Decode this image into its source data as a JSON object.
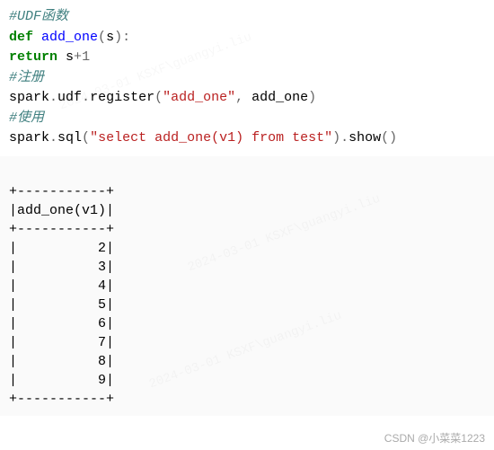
{
  "code": {
    "comment1": "#UDF函数",
    "kw_def": "def",
    "func_name": "add_one",
    "param": "s",
    "kw_return": "return",
    "return_expr_var": "s",
    "return_expr_op": "+",
    "return_expr_num": "1",
    "comment2": "#注册",
    "register_obj": "spark",
    "register_dot1": ".",
    "register_udf": "udf",
    "register_dot2": ".",
    "register_method": "register",
    "register_arg1": "\"add_one\"",
    "register_comma": ", ",
    "register_arg2": "add_one",
    "comment3": "#使用",
    "use_obj": "spark",
    "use_dot1": ".",
    "use_sql": "sql",
    "use_arg": "\"select add_one(v1) from test\"",
    "use_dot2": ".",
    "use_show": "show",
    "use_parens": "()"
  },
  "output": {
    "sep": "+-----------+",
    "header": "|add_one(v1)|",
    "rows": [
      "|          2|",
      "|          3|",
      "|          4|",
      "|          5|",
      "|          6|",
      "|          7|",
      "|          8|",
      "|          9|"
    ]
  },
  "credit": "CSDN @小菜菜1223",
  "watermark": "2024-03-01  KSXF\\guangyi.liu"
}
